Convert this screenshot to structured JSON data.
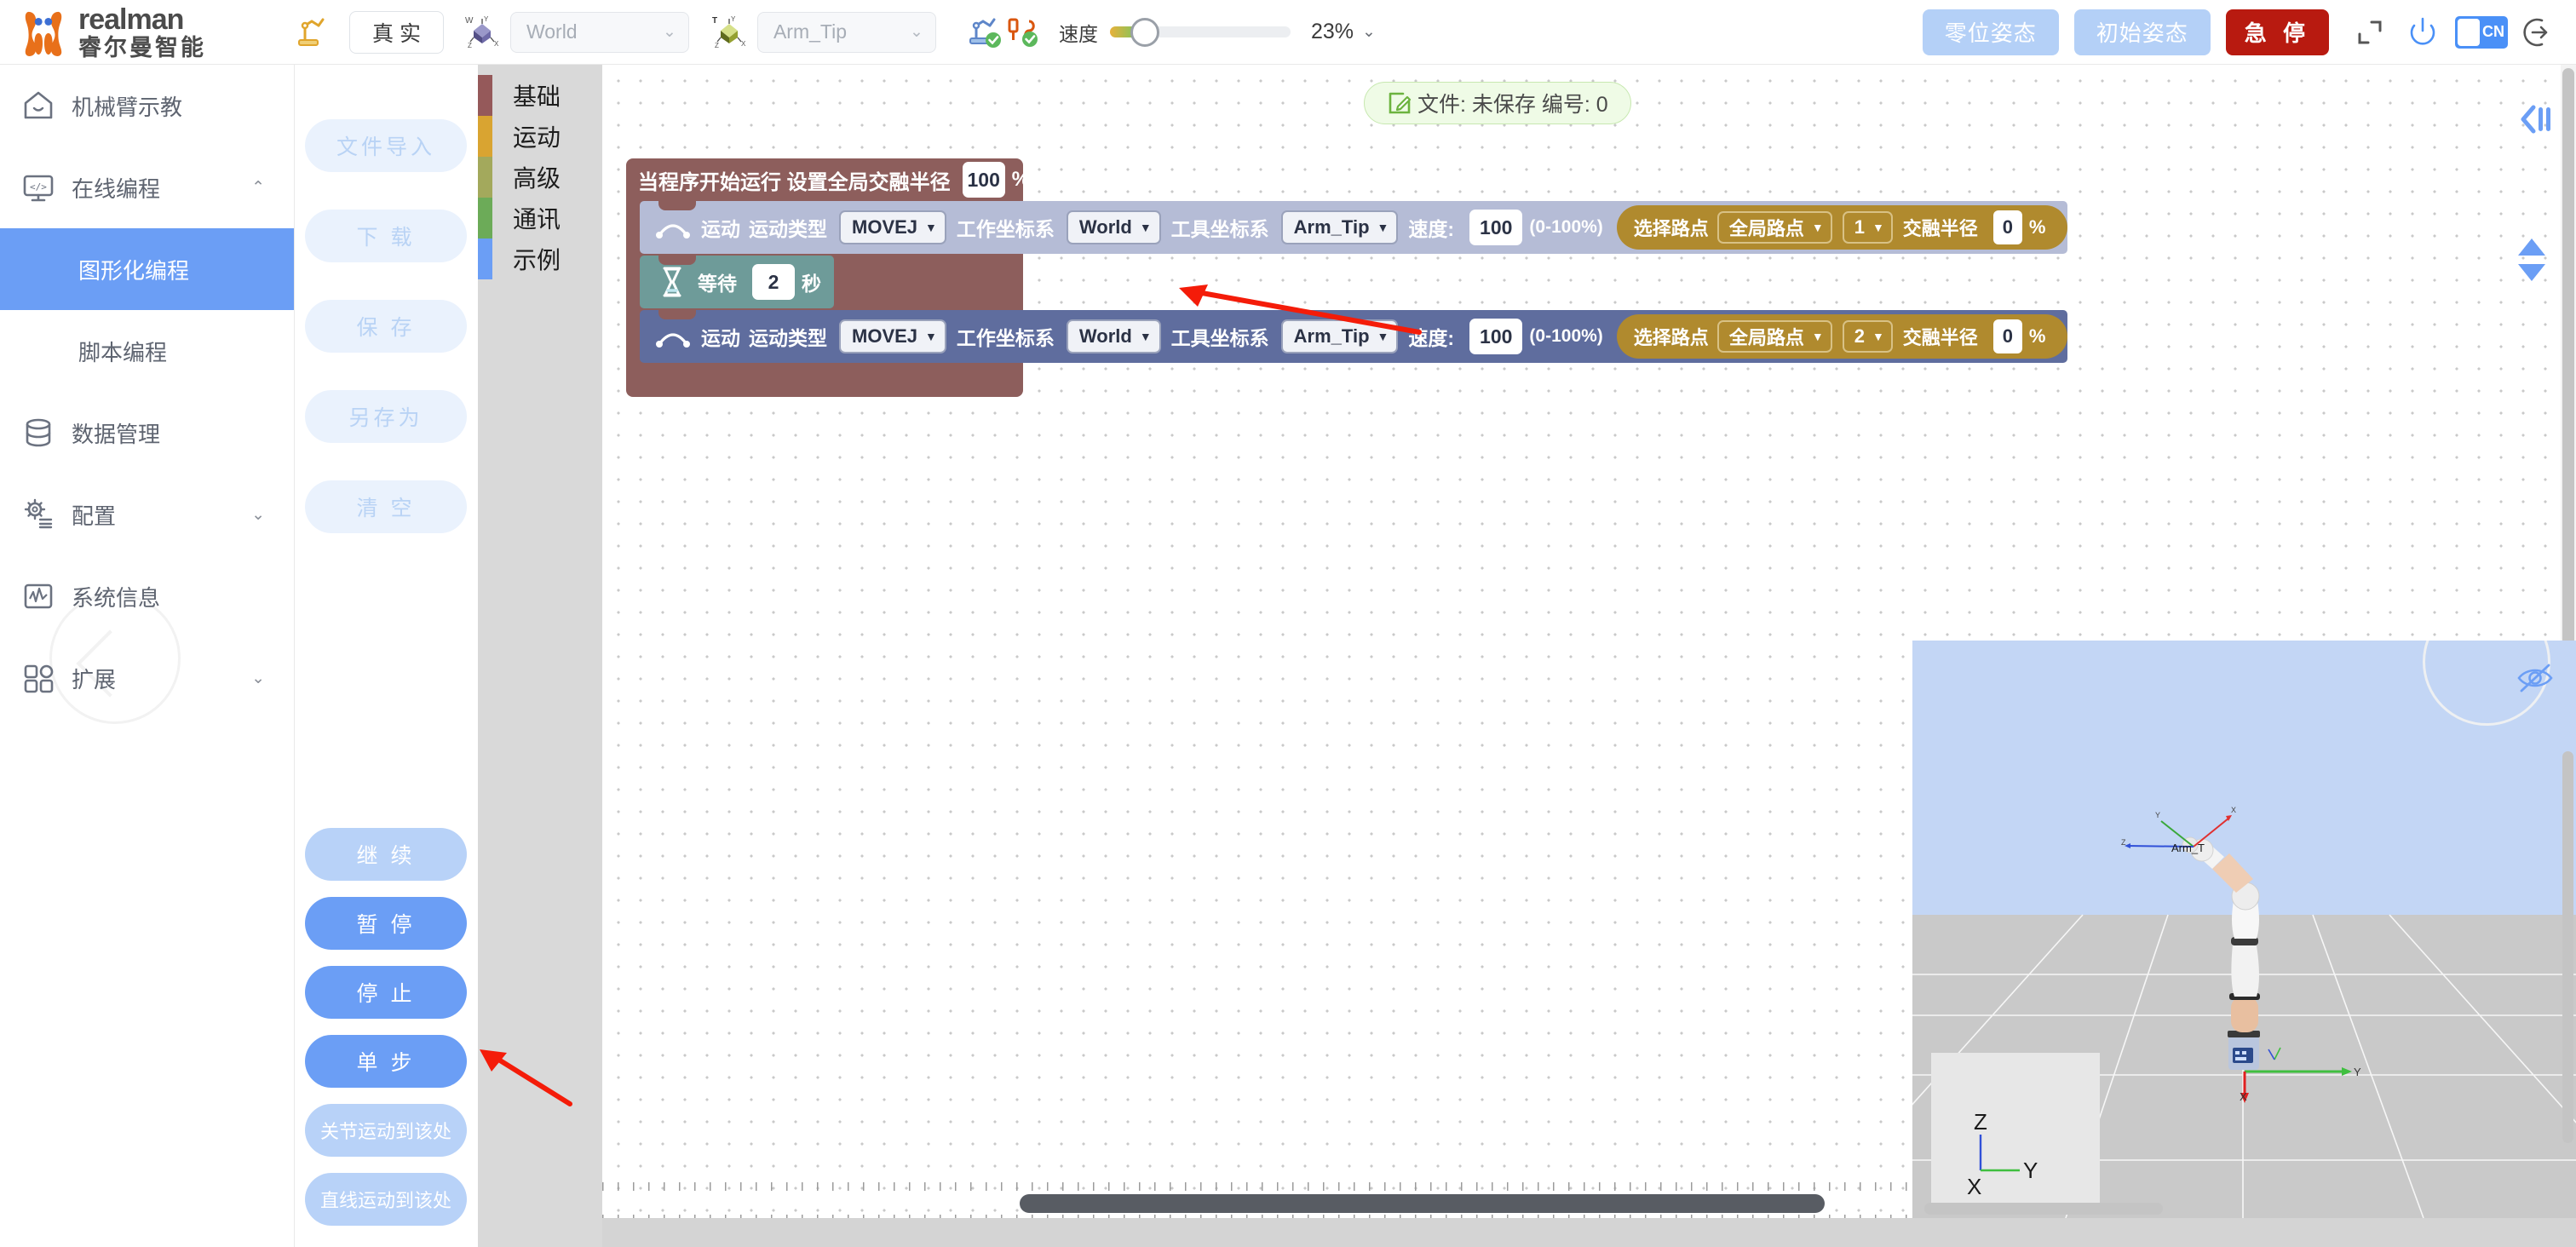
{
  "brand": {
    "en": "realman",
    "cn": "睿尔曼智能"
  },
  "header": {
    "mode_button": "真 实",
    "work_frame": {
      "icon": "world-axes-icon",
      "value": "World",
      "chevron": "⌄"
    },
    "tool_frame": {
      "icon": "tool-axes-icon",
      "value": "Arm_Tip",
      "chevron": "⌄"
    },
    "status_icons": [
      "teach-pendant-ok-icon",
      "cable-connected-ok-icon"
    ],
    "speed_label": "速度",
    "speed_value": "23%",
    "speed_percent": 23,
    "speed_chevron": "⌄",
    "zero_pose_button": "零位姿态",
    "init_pose_button": "初始姿态",
    "estop_button": "急 停",
    "fullscreen_icon": "fullscreen-icon",
    "power_icon": "power-icon",
    "language_toggle": "CN",
    "logout_icon": "logout-icon"
  },
  "sidebar": {
    "items": [
      {
        "label": "机械臂示教",
        "icon": "home-icon",
        "caret": ""
      },
      {
        "label": "在线编程",
        "icon": "code-monitor-icon",
        "caret": "⌃"
      },
      {
        "label": "数据管理",
        "icon": "database-icon",
        "caret": ""
      },
      {
        "label": "配置",
        "icon": "gear-icon",
        "caret": "⌄"
      },
      {
        "label": "系统信息",
        "icon": "chart-monitor-icon",
        "caret": ""
      },
      {
        "label": "扩展",
        "icon": "blocks-icon",
        "caret": "⌄"
      }
    ],
    "sub_items": [
      {
        "label": "图形化编程",
        "active": true
      },
      {
        "label": "脚本编程",
        "active": false
      }
    ]
  },
  "actions": {
    "file_buttons": [
      {
        "label": "文件导入",
        "style": "ghost"
      },
      {
        "label": "下 载",
        "style": "ghost"
      },
      {
        "label": "保 存",
        "style": "ghost"
      },
      {
        "label": "另存为",
        "style": "ghost"
      },
      {
        "label": "清 空",
        "style": "ghost"
      }
    ],
    "run_buttons": [
      {
        "label": "继 续",
        "style": "light"
      },
      {
        "label": "暂 停",
        "style": "solid"
      },
      {
        "label": "停 止",
        "style": "solid"
      },
      {
        "label": "单 步",
        "style": "solid"
      },
      {
        "label": "关节运动到该处",
        "style": "light",
        "small": true
      },
      {
        "label": "直线运动到该处",
        "style": "light",
        "small": true
      }
    ]
  },
  "categories": [
    {
      "label": "基础",
      "color": "#95595a"
    },
    {
      "label": "运动",
      "color": "#d9a431"
    },
    {
      "label": "高级",
      "color": "#a3a95c"
    },
    {
      "label": "通讯",
      "color": "#6cab58"
    },
    {
      "label": "示例",
      "color": "#6b9ef5"
    }
  ],
  "canvas": {
    "file_chip": {
      "icon": "edit-file-icon",
      "text": "文件: 未保存  编号: 0"
    },
    "collapse_icon": "collapse-panel-icon",
    "zoom_nav_icon": "zoom-updown-icon"
  },
  "program": {
    "hat": {
      "text_before": "当程序开始运行  设置全局交融半径",
      "value": "100",
      "unit": "%"
    },
    "blocks": [
      {
        "type": "motion",
        "icon": "motion-arc-icon",
        "name": "运动",
        "motion_type_label": "运动类型",
        "motion_type_value": "MOVEJ",
        "work_frame_label": "工作坐标系",
        "work_frame_value": "World",
        "tool_frame_label": "工具坐标系",
        "tool_frame_value": "Arm_Tip",
        "speed_label": "速度:",
        "speed_value": "100",
        "speed_hint": "(0-100%)",
        "waypoint_label": "选择路点",
        "waypoint_source": "全局路点",
        "waypoint_index": "1",
        "blend_label": "交融半径",
        "blend_value": "0",
        "blend_unit": "%"
      },
      {
        "type": "wait",
        "icon": "hourglass-icon",
        "name": "等待",
        "value": "2",
        "unit": "秒"
      },
      {
        "type": "motion",
        "icon": "motion-arc-icon",
        "name": "运动",
        "motion_type_label": "运动类型",
        "motion_type_value": "MOVEJ",
        "work_frame_label": "工作坐标系",
        "work_frame_value": "World",
        "tool_frame_label": "工具坐标系",
        "tool_frame_value": "Arm_Tip",
        "speed_label": "速度:",
        "speed_value": "100",
        "speed_hint": "(0-100%)",
        "waypoint_label": "选择路点",
        "waypoint_source": "全局路点",
        "waypoint_index": "2",
        "blend_label": "交融半径",
        "blend_value": "0",
        "blend_unit": "%"
      }
    ]
  },
  "viewport": {
    "eye_icon": "eye-hidden-icon",
    "axis_z": "Z",
    "axis_y": "Y",
    "axis_x": "X",
    "tool_label": "Arm_T",
    "ground_axis_y": "Y",
    "ground_axis_x": "X"
  },
  "colors": {
    "accent_blue": "#6b9ef5",
    "estop_red": "#b81a10",
    "block_wrapper": "#8d5e5c",
    "block_motion_a": "#b5bcd6",
    "block_wait": "#6e9b99",
    "block_motion_b": "#5f6d9e",
    "waypoint_gold": "#b08a2e",
    "annotation_arrow": "#f41c09"
  }
}
